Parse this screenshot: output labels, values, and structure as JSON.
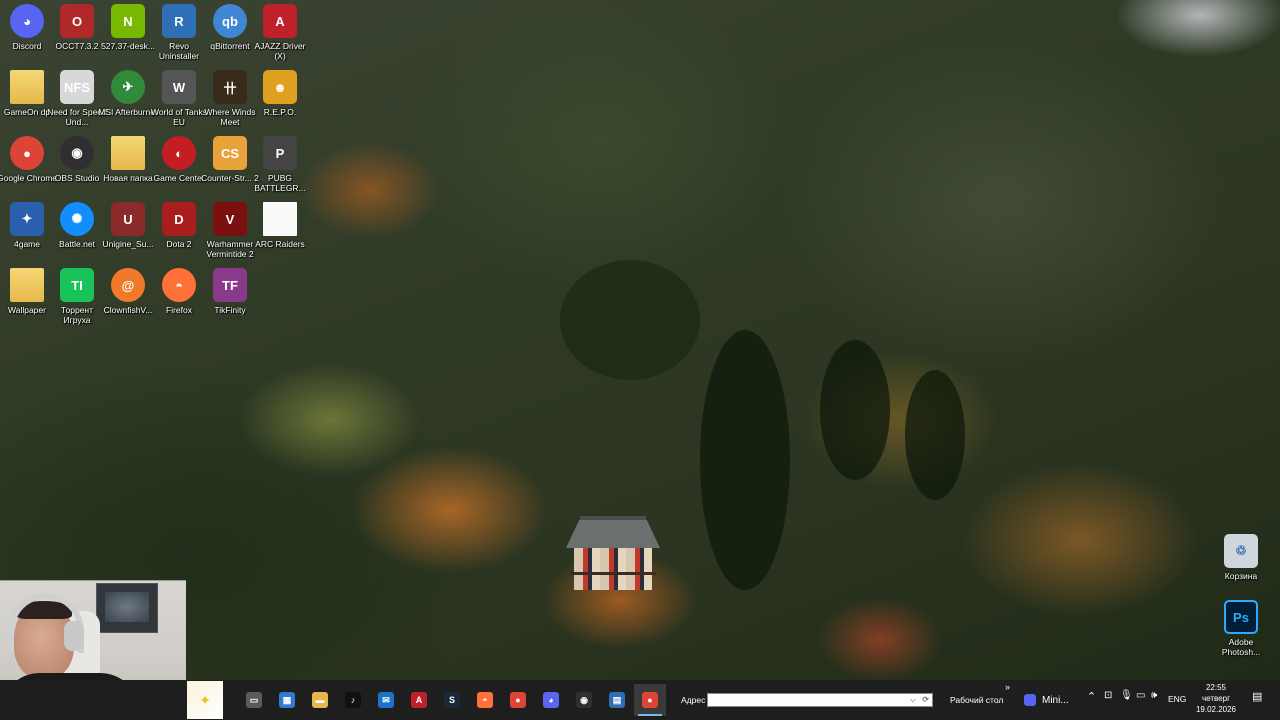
{
  "desktop_icons": [
    {
      "label": "Discord",
      "glyph": "◕",
      "color": "#5865f2",
      "icon": "discord-icon"
    },
    {
      "label": "OCCT7.3.2",
      "glyph": "O",
      "color": "#b0282a",
      "icon": "occt-icon"
    },
    {
      "label": "527.37-desk...",
      "glyph": "N",
      "color": "#76b900",
      "icon": "nvidia-installer-icon"
    },
    {
      "label": "Revo Uninstaller",
      "glyph": "R",
      "color": "#2f6fb5",
      "icon": "revo-uninstaller-icon"
    },
    {
      "label": "qBittorrent",
      "glyph": "qb",
      "color": "#3f87d3",
      "icon": "qbittorrent-icon"
    },
    {
      "label": "AJAZZ Driver (X)",
      "glyph": "A",
      "color": "#c0202a",
      "icon": "ajazz-driver-icon"
    },
    {
      "label": "GameOn dp",
      "glyph": "",
      "color": "#e6b84a",
      "icon": "folder-icon"
    },
    {
      "label": "Need for Speed Und...",
      "glyph": "NFS",
      "color": "#d8d8d8",
      "icon": "need-for-speed-icon"
    },
    {
      "label": "MSI Afterburner",
      "glyph": "✈",
      "color": "#2f8a3a",
      "icon": "msi-afterburner-icon"
    },
    {
      "label": "World of Tanks EU",
      "glyph": "W",
      "color": "#555555",
      "icon": "world-of-tanks-icon"
    },
    {
      "label": "Where Winds Meet",
      "glyph": "卄",
      "color": "#3a2a1a",
      "icon": "where-winds-meet-icon"
    },
    {
      "label": "R.E.P.O.",
      "glyph": "☻",
      "color": "#e0a020",
      "icon": "repo-game-icon"
    },
    {
      "label": "Google Chrome",
      "glyph": "●",
      "color": "#db4437",
      "icon": "chrome-icon"
    },
    {
      "label": "OBS Studio",
      "glyph": "◉",
      "color": "#302e31",
      "icon": "obs-icon"
    },
    {
      "label": "Новая папка",
      "glyph": "",
      "color": "#e6b84a",
      "icon": "folder-icon"
    },
    {
      "label": "Game Center",
      "glyph": "◐",
      "color": "#c41e24",
      "icon": "game-center-icon"
    },
    {
      "label": "Counter-Str... 2",
      "glyph": "CS",
      "color": "#e8a23a",
      "icon": "counter-strike-icon"
    },
    {
      "label": "PUBG BATTLEGR...",
      "glyph": "P",
      "color": "#444444",
      "icon": "pubg-icon"
    },
    {
      "label": "4game",
      "glyph": "✦",
      "color": "#2a5fb0",
      "icon": "4game-icon"
    },
    {
      "label": "Battle.net",
      "glyph": "✺",
      "color": "#148eff",
      "icon": "battlenet-icon"
    },
    {
      "label": "Unigine_Su...",
      "glyph": "U",
      "color": "#8a2a2a",
      "icon": "unigine-icon"
    },
    {
      "label": "Dota 2",
      "glyph": "D",
      "color": "#a81e1e",
      "icon": "dota2-icon"
    },
    {
      "label": "Warhammer Vermintide 2",
      "glyph": "V",
      "color": "#7a1010",
      "icon": "vermintide-icon"
    },
    {
      "label": "ARC Raiders",
      "glyph": "",
      "color": "#fafafa",
      "icon": "document-icon"
    },
    {
      "label": "Wallpaper",
      "glyph": "",
      "color": "#e6b84a",
      "icon": "folder-icon"
    },
    {
      "label": "Торрент Игруха",
      "glyph": "TI",
      "color": "#18c45a",
      "icon": "torrent-igruha-icon"
    },
    {
      "label": "ClownfishV...",
      "glyph": "@",
      "color": "#f07a2a",
      "icon": "clownfish-icon"
    },
    {
      "label": "Firefox",
      "glyph": "◓",
      "color": "#ff7139",
      "icon": "firefox-icon"
    },
    {
      "label": "TikFinity",
      "glyph": "TF",
      "color": "#8a3a8a",
      "icon": "tikfinity-icon"
    }
  ],
  "right_icons": [
    {
      "label": "Корзина",
      "glyph": "♲",
      "color": "#cfd6de",
      "icon": "recycle-bin-icon"
    },
    {
      "label": "Adobe Photosh...",
      "glyph": "Ps",
      "color": "#001e36",
      "icon": "photoshop-icon"
    }
  ],
  "taskbar": {
    "pinned": [
      {
        "glyph": "▭",
        "color": "#5a5a5a",
        "icon": "task-view-icon"
      },
      {
        "glyph": "▦",
        "color": "#2f7bd1",
        "icon": "store-icon"
      },
      {
        "glyph": "▬",
        "color": "#e6b84a",
        "icon": "file-explorer-icon"
      },
      {
        "glyph": "♪",
        "color": "#111111",
        "icon": "tiktok-icon"
      },
      {
        "glyph": "✉",
        "color": "#1a73c8",
        "icon": "mail-icon"
      },
      {
        "glyph": "A",
        "color": "#c0202a",
        "icon": "ajazz-taskbar-icon"
      },
      {
        "glyph": "S",
        "color": "#1b2838",
        "icon": "steam-icon"
      },
      {
        "glyph": "◓",
        "color": "#ff7139",
        "icon": "firefox-taskbar-icon"
      },
      {
        "glyph": "●",
        "color": "#db4437",
        "icon": "chrome-taskbar-icon"
      },
      {
        "glyph": "◕",
        "color": "#5865f2",
        "icon": "discord-taskbar-icon"
      },
      {
        "glyph": "◉",
        "color": "#302e31",
        "icon": "obs-taskbar-icon"
      },
      {
        "glyph": "▤",
        "color": "#2f6fb5",
        "icon": "app-taskbar-icon"
      },
      {
        "glyph": "●",
        "color": "#db4437",
        "icon": "chrome-active-taskbar-icon"
      }
    ],
    "address_label": "Адрес",
    "address_value": "",
    "desktop_toolbar_label": "Рабочий стол",
    "chevron": "»",
    "mini_app_label": "Mini...",
    "language": "ENG",
    "clock": {
      "time": "22:55",
      "weekday": "четверг",
      "date": "19.02.2026"
    }
  }
}
